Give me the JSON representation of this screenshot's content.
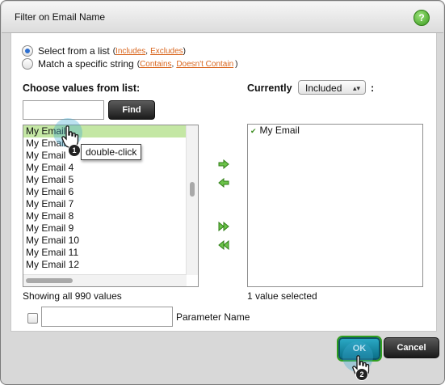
{
  "dialog": {
    "title": "Filter on Email Name",
    "help_glyph": "?"
  },
  "mode": {
    "list_label": "Select from a list",
    "list_paren_open": "(",
    "includes_link": "Includes",
    "sep": ",",
    "excludes_link": "Excludes",
    "paren_close": ")",
    "string_label": "Match a specific string",
    "contains_link": "Contains",
    "not_contains_link": "Doesn't Contain",
    "selected": "list"
  },
  "left": {
    "header": "Choose values from list:",
    "search_value": "",
    "find_label": "Find",
    "items": [
      "My Email",
      "My Email 2",
      "My Email 3",
      "My Email 4",
      "My Email 5",
      "My Email 6",
      "My Email 7",
      "My Email 8",
      "My Email 9",
      "My Email 10",
      "My Email 11",
      "My Email 12"
    ],
    "items_visible": [
      "My Email",
      "My Email",
      "My Email",
      "My Email 4",
      "My Email 5",
      "My Email 6",
      "My Email 7",
      "My Email 8",
      "My Email 9",
      "My Email 10",
      "My Email 11",
      "My Email 12"
    ],
    "status": "Showing all 990 values"
  },
  "right": {
    "header": "Currently",
    "colon": ":",
    "mode_value": "Included",
    "selected_items": [
      "My Email"
    ],
    "status": "1 value selected"
  },
  "parameter": {
    "value": "",
    "label": "Parameter Name",
    "checked": false
  },
  "buttons": {
    "ok": "OK",
    "cancel": "Cancel"
  },
  "annotations": {
    "step1": "1",
    "tooltip": "double-click",
    "step2": "2"
  },
  "colors": {
    "link": "#d9661e",
    "selected_row": "#c4e7a4",
    "arrow": "#4cae2c",
    "ok_button": "#1b8aa6"
  }
}
